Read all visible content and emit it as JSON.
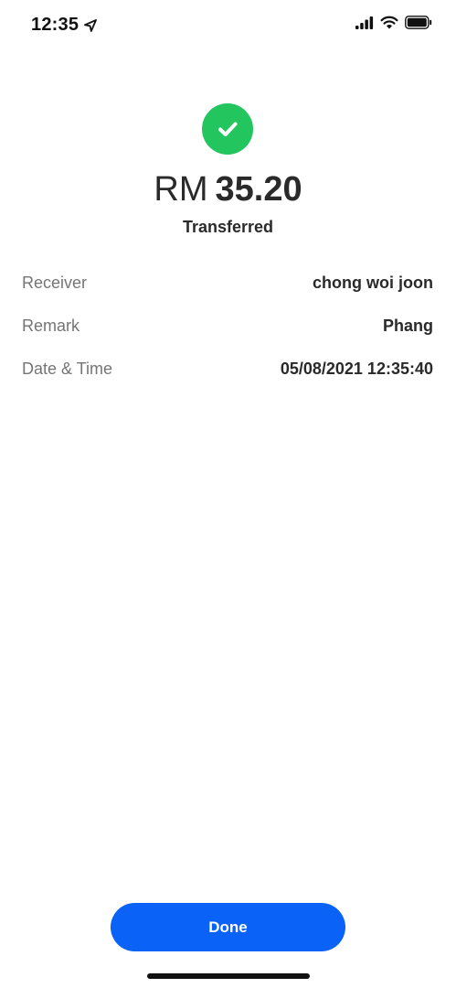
{
  "status_bar": {
    "time": "12:35"
  },
  "transaction": {
    "currency": "RM",
    "amount": "35.20",
    "status": "Transferred"
  },
  "details": [
    {
      "label": "Receiver",
      "value": "chong woi joon"
    },
    {
      "label": "Remark",
      "value": "Phang"
    },
    {
      "label": "Date & Time",
      "value": "05/08/2021 12:35:40"
    }
  ],
  "actions": {
    "done_label": "Done"
  },
  "colors": {
    "success": "#22c55e",
    "primary_button": "#0a63f6"
  }
}
